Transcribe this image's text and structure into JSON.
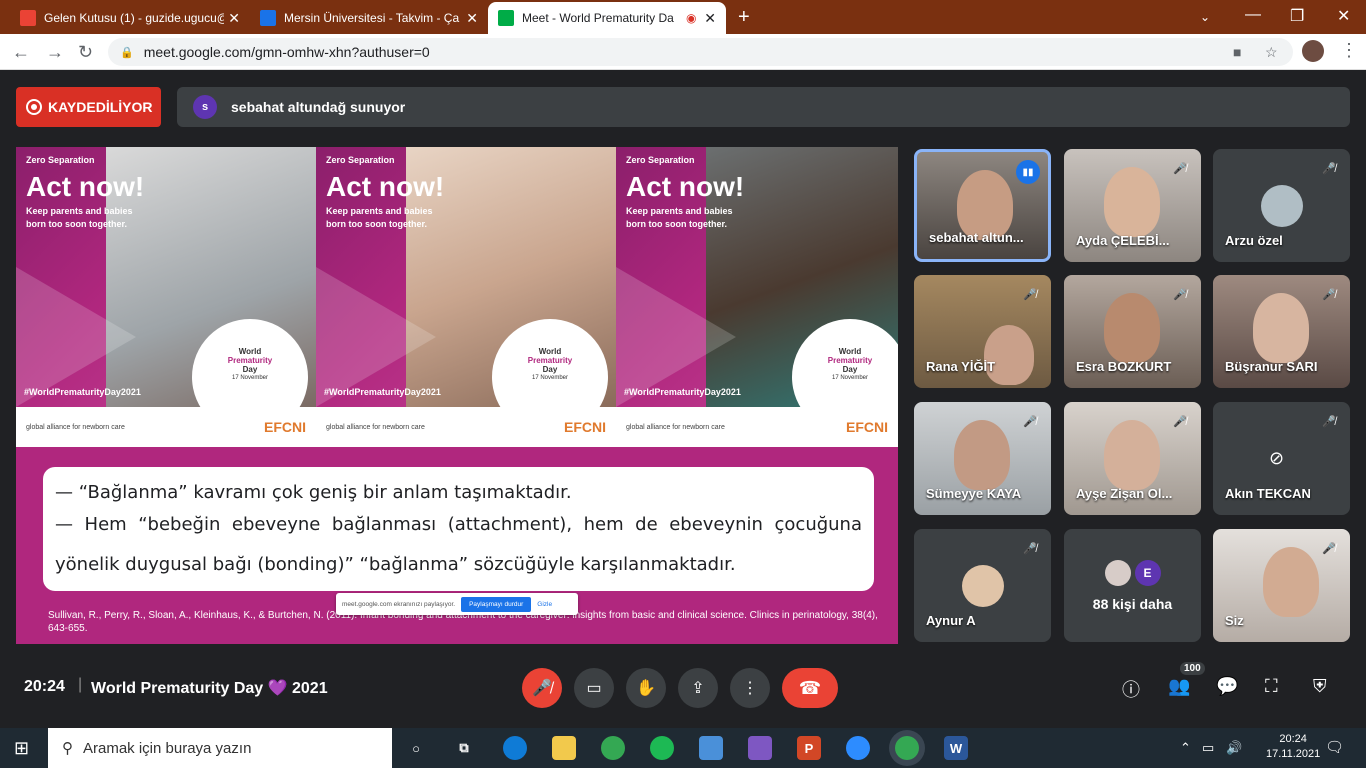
{
  "tabs": [
    {
      "title": "Gelen Kutusu (1) - guzide.ugucu@",
      "favicon": "gmail-icon",
      "color": "#ea4335"
    },
    {
      "title": "Mersin Üniversitesi - Takvim - Ça",
      "favicon": "calendar-icon",
      "color": "#1a73e8"
    },
    {
      "title": "Meet - World Prematurity Da",
      "favicon": "meet-icon",
      "color": "#00ac47"
    }
  ],
  "address": {
    "url": "meet.google.com/gmn-omhw-xhn?authuser=0"
  },
  "meet": {
    "recording_label": "KAYDEDİLİYOR",
    "presenter_initial": "s",
    "presenter_text": "sebahat altundağ sunuyor",
    "slide": {
      "poster_kicker": "Zero Separation",
      "poster_title": "Act now!",
      "poster_sub": "Keep parents and babies born too soon together.",
      "poster_hashtag": "#WorldPrematurityDay2021",
      "circle_l1": "World",
      "circle_l2": "Prematurity",
      "circle_l3": "Day",
      "circle_date": "17 November",
      "logo_left": "global alliance for newborn care",
      "logo_right": "EFCNI",
      "bullet1": "— “Bağlanma” kavramı çok geniş bir anlam taşımaktadır.",
      "bullet2": "— Hem “bebeğin ebeveyne bağlanması (attachment), hem de ebeveynin çocuğuna yönelik duygusal bağı (bonding)” “bağlanma” sözcüğüyle karşılanmaktadır.",
      "citation": "Sullivan, R., Perry, R., Sloan, A., Kleinhaus, K., & Burtchen, N. (2011). Infant bonding and attachment to the caregiver: insights from basic and clinical science. Clinics in perinatology, 38(4), 643-655.",
      "share_text": "meet.google.com ekranınızı paylaşıyor.",
      "share_stop": "Paylaşmayı durdur",
      "share_hide": "Gizle"
    },
    "participants": [
      {
        "name": "sebahat altun...",
        "state": "speaking"
      },
      {
        "name": "Ayda ÇELEBİ...",
        "state": "muted"
      },
      {
        "name": "Arzu özel",
        "state": "muted"
      },
      {
        "name": "Rana YİĞİT",
        "state": "muted"
      },
      {
        "name": "Esra BOZKURT",
        "state": "muted"
      },
      {
        "name": "Büşranur SARI",
        "state": "muted"
      },
      {
        "name": "Sümeyye KAYA",
        "state": "muted"
      },
      {
        "name": "Ayşe Zişan Ol...",
        "state": "muted"
      },
      {
        "name": "Akın TEKCAN",
        "state": "camera-off"
      },
      {
        "name": "Aynur A",
        "state": "muted"
      },
      {
        "name": "88 kişi daha",
        "state": "more",
        "initial": "E"
      },
      {
        "name": "Siz",
        "state": "muted"
      }
    ],
    "time": "20:24",
    "title": "World Prematurity Day 💜 2021",
    "participant_count": "100"
  },
  "taskbar": {
    "search_placeholder": "Aramak için buraya yazın",
    "time": "20:24",
    "date": "17.11.2021"
  }
}
